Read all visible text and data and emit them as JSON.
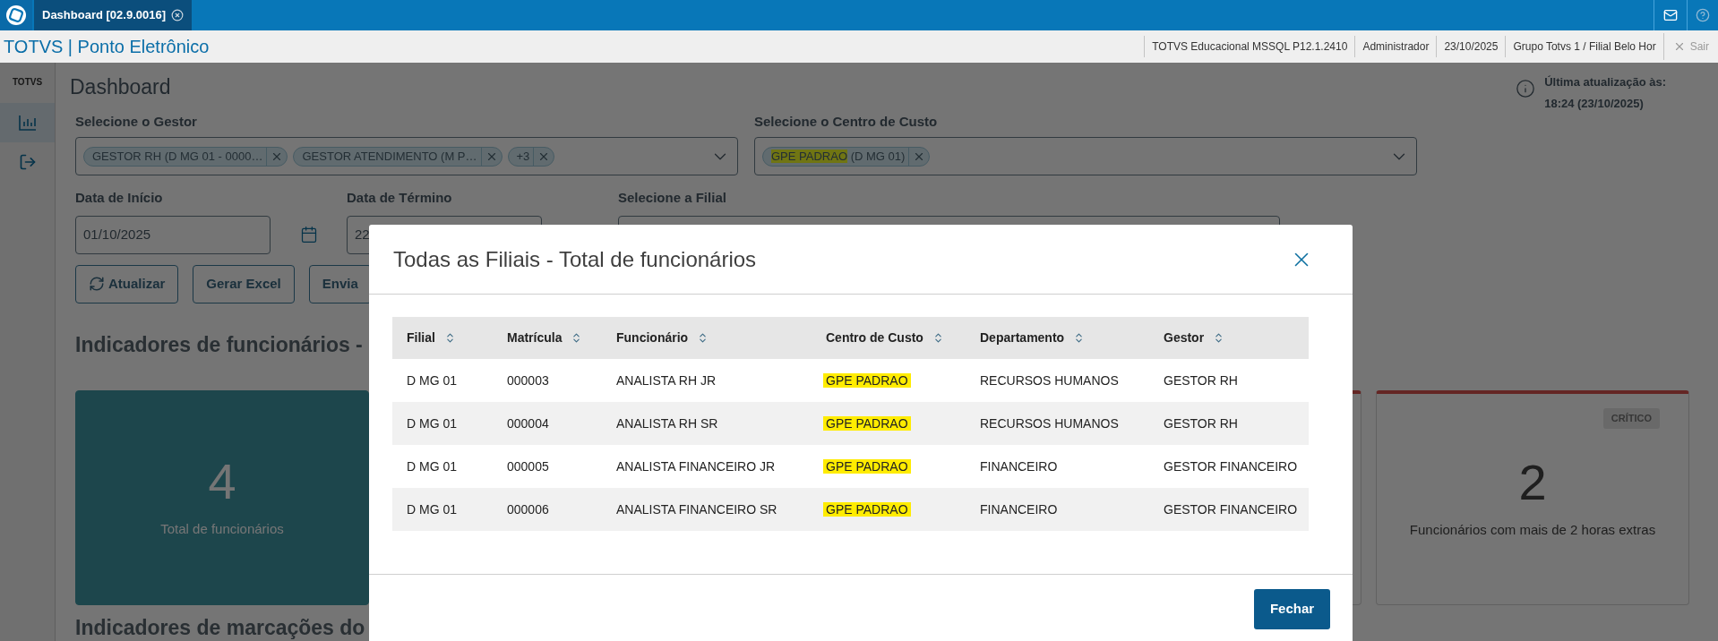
{
  "app_bar": {
    "tab": {
      "label": "Dashboard [02.9.0016]",
      "selected": true
    }
  },
  "header": {
    "title": "TOTVS | Ponto Eletrônico",
    "info": [
      "TOTVS Educacional MSSQL P12.1.2410",
      "Administrador",
      "23/10/2025",
      "Grupo Totvs 1 / Filial Belo Hor"
    ],
    "logout": "Sair"
  },
  "sidebar": {
    "logo": "TOTVS",
    "items": [
      {
        "kind": "chart",
        "selected": true
      },
      {
        "kind": "logout",
        "selected": false
      }
    ]
  },
  "dashboard": {
    "title": "Dashboard",
    "last_update": {
      "label": "Última atualização às:",
      "value": "18:24 (23/10/2025)"
    },
    "gestor": {
      "label": "Selecione o Gestor",
      "chips": [
        {
          "parts": [
            {
              "text": "GESTOR RH (D MG 01 - 0000…",
              "highlighted": false
            }
          ]
        },
        {
          "parts": [
            {
              "text": "GESTOR ATENDIMENTO (M P…",
              "highlighted": false
            }
          ]
        },
        {
          "parts": [
            {
              "text": "+3",
              "highlighted": false
            }
          ]
        }
      ]
    },
    "centro": {
      "label": "Selecione o Centro de Custo",
      "chips": [
        {
          "parts": [
            {
              "text": "GPE PADRAO",
              "highlighted": true
            },
            {
              "text": " (D MG 01)",
              "highlighted": false
            }
          ]
        }
      ]
    },
    "start": {
      "label": "Data de Início",
      "value": "01/10/2025"
    },
    "end": {
      "label": "Data de Término",
      "value": "22"
    },
    "filial": {
      "label": "Selecione a Filial"
    },
    "buttons": [
      {
        "label": "Atualizar",
        "kind": "refresh"
      },
      {
        "label": "Gerar Excel",
        "kind": "plain"
      },
      {
        "label": "Envia",
        "kind": "plain"
      }
    ],
    "section_title": "Indicadores de funcionários -",
    "cards": [
      {
        "kind": "filled",
        "value": "4",
        "label": "Total de funcionários",
        "critical": false
      },
      {
        "kind": "outlined",
        "critical": true
      },
      {
        "kind": "outlined",
        "critical": true,
        "badge": "CRÍTICO",
        "value": "2",
        "label": "Funcionários com mais de 2 horas extras"
      }
    ],
    "section_title_2": "Indicadores de marcações do"
  },
  "modal": {
    "title": "Todas as Filiais - Total de funcionários",
    "columns": [
      "Filial",
      "Matrícula",
      "Funcionário",
      "Centro de Custo",
      "Departamento",
      "Gestor"
    ],
    "rows": [
      {
        "filial": "D MG 01",
        "matricula": "000003",
        "funcionario": "ANALISTA RH JR",
        "centro": {
          "text": "GPE PADRAO",
          "highlighted": true
        },
        "departamento": "RECURSOS HUMANOS",
        "gestor": "GESTOR RH"
      },
      {
        "filial": "D MG 01",
        "matricula": "000004",
        "funcionario": "ANALISTA RH SR",
        "centro": {
          "text": "GPE PADRAO",
          "highlighted": true
        },
        "departamento": "RECURSOS HUMANOS",
        "gestor": "GESTOR RH"
      },
      {
        "filial": "D MG 01",
        "matricula": "000005",
        "funcionario": "ANALISTA FINANCEIRO JR",
        "centro": {
          "text": "GPE PADRAO",
          "highlighted": true
        },
        "departamento": "FINANCEIRO",
        "gestor": "GESTOR FINANCEIRO"
      },
      {
        "filial": "D MG 01",
        "matricula": "000006",
        "funcionario": "ANALISTA FINANCEIRO SR",
        "centro": {
          "text": "GPE PADRAO",
          "highlighted": true
        },
        "departamento": "FINANCEIRO",
        "gestor": "GESTOR FINANCEIRO"
      }
    ],
    "close_button": "Fechar"
  }
}
